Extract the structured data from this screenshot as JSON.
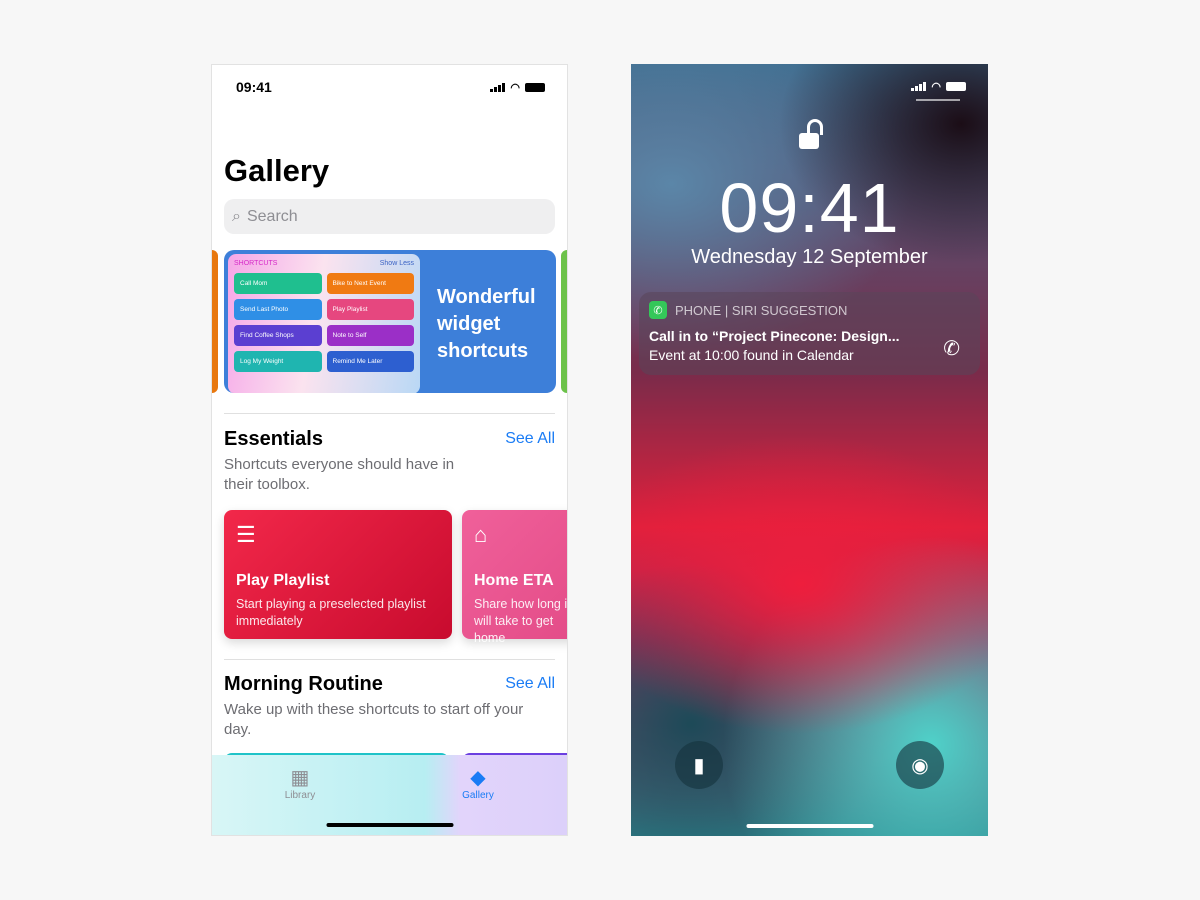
{
  "left_phone": {
    "status_time": "09:41",
    "title": "Gallery",
    "search_placeholder": "Search",
    "hero": {
      "widget_app": "SHORTCUTS",
      "widget_toggle": "Show Less",
      "widget_items": [
        {
          "label": "Call Mom",
          "color": "#1fbf8f",
          "icon": "phone-icon"
        },
        {
          "label": "Bike to Next Event",
          "color": "#f07a12",
          "icon": "pin-icon"
        },
        {
          "label": "Send Last Photo",
          "color": "#2f8fe6",
          "icon": "camera-icon"
        },
        {
          "label": "Play Playlist",
          "color": "#e6477f",
          "icon": "music-icon"
        },
        {
          "label": "Find Coffee Shops",
          "color": "#5b3fd1",
          "icon": "cup-icon"
        },
        {
          "label": "Note to Self",
          "color": "#9b2fc7",
          "icon": "mail-icon"
        },
        {
          "label": "Log My Weight",
          "color": "#1fb5b0",
          "icon": "person-icon"
        },
        {
          "label": "Remind Me Later",
          "color": "#2d5fd0",
          "icon": "clock-icon"
        }
      ],
      "headline": "Wonderful widget shortcuts"
    },
    "sections": [
      {
        "title": "Essentials",
        "see_all": "See All",
        "description": "Shortcuts everyone should have in their toolbox."
      },
      {
        "title": "Morning Routine",
        "see_all": "See All",
        "description": "Wake up with these shortcuts to start off your day."
      }
    ],
    "cards": [
      {
        "title": "Play Playlist",
        "description": "Start playing a preselected playlist immediately",
        "icon": "list-icon",
        "color": "#e01d41"
      },
      {
        "title": "Home ETA",
        "description": "Share how long it will take to get home",
        "icon": "home-icon",
        "color": "#ef5a93"
      }
    ],
    "tabs": [
      {
        "label": "Library",
        "icon": "grid-icon",
        "active": false
      },
      {
        "label": "Gallery",
        "icon": "layers-icon",
        "active": true
      }
    ]
  },
  "right_phone": {
    "time": "09:41",
    "date": "Wednesday 12 September",
    "notification": {
      "app": "PHONE | SIRI SUGGESTION",
      "title": "Call in to “Project Pinecone: Design...",
      "body": "Event at 10:00 found in Calendar"
    },
    "lock_state": "unlocked"
  }
}
